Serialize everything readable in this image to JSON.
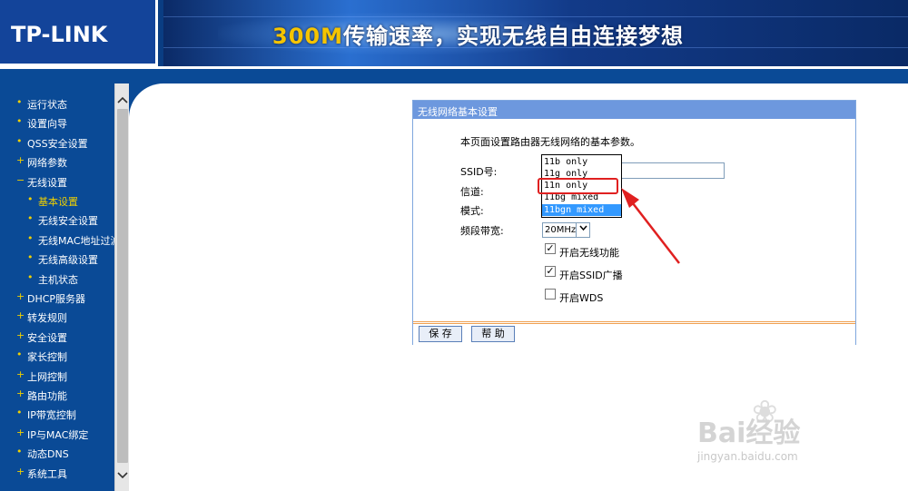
{
  "header": {
    "logo": "TP-LINK",
    "slogan_num": "300M",
    "slogan_text": "传输速率，实现无线自由连接梦想"
  },
  "sidebar": {
    "items": [
      {
        "label": "运行状态",
        "bullet": "•",
        "indent": false,
        "active": false
      },
      {
        "label": "设置向导",
        "bullet": "•",
        "indent": false,
        "active": false
      },
      {
        "label": "QSS安全设置",
        "bullet": "•",
        "indent": false,
        "active": false
      },
      {
        "label": "网络参数",
        "bullet": "+",
        "indent": false,
        "active": false
      },
      {
        "label": "无线设置",
        "bullet": "−",
        "indent": false,
        "active": false
      },
      {
        "label": "基本设置",
        "bullet": "•",
        "indent": true,
        "active": true
      },
      {
        "label": "无线安全设置",
        "bullet": "•",
        "indent": true,
        "active": false
      },
      {
        "label": "无线MAC地址过滤",
        "bullet": "•",
        "indent": true,
        "active": false
      },
      {
        "label": "无线高级设置",
        "bullet": "•",
        "indent": true,
        "active": false
      },
      {
        "label": "主机状态",
        "bullet": "•",
        "indent": true,
        "active": false
      },
      {
        "label": "DHCP服务器",
        "bullet": "+",
        "indent": false,
        "active": false
      },
      {
        "label": "转发规则",
        "bullet": "+",
        "indent": false,
        "active": false
      },
      {
        "label": "安全设置",
        "bullet": "+",
        "indent": false,
        "active": false
      },
      {
        "label": "家长控制",
        "bullet": "•",
        "indent": false,
        "active": false
      },
      {
        "label": "上网控制",
        "bullet": "+",
        "indent": false,
        "active": false
      },
      {
        "label": "路由功能",
        "bullet": "+",
        "indent": false,
        "active": false
      },
      {
        "label": "IP带宽控制",
        "bullet": "•",
        "indent": false,
        "active": false
      },
      {
        "label": "IP与MAC绑定",
        "bullet": "+",
        "indent": false,
        "active": false
      },
      {
        "label": "动态DNS",
        "bullet": "•",
        "indent": false,
        "active": false
      },
      {
        "label": "系统工具",
        "bullet": "+",
        "indent": false,
        "active": false
      }
    ]
  },
  "panel": {
    "title": "无线网络基本设置",
    "description": "本页面设置路由器无线网络的基本参数。",
    "ssid_label": "SSID号:",
    "channel_label": "信道:",
    "mode_label": "模式:",
    "bandwidth_label": "频段带宽:",
    "bandwidth_value": "20MHz",
    "checkboxes": [
      {
        "label": "开启无线功能",
        "checked": true
      },
      {
        "label": "开启SSID广播",
        "checked": true
      },
      {
        "label": "开启WDS",
        "checked": false
      }
    ],
    "save_label": "保 存",
    "help_label": "帮 助"
  },
  "mode_dropdown": {
    "options": [
      "11b only",
      "11g only",
      "11n only",
      "11bg mixed",
      "11bgn mixed"
    ],
    "selected": "11bgn mixed",
    "highlighted": "11n only"
  },
  "watermark": {
    "logo": "Bai经验",
    "url": "jingyan.baidu.com"
  },
  "colors": {
    "header_blue": "#0a4a96",
    "panel_title": "#6d98de",
    "accent_yellow": "#f0d000",
    "annotation_red": "#e02020"
  }
}
